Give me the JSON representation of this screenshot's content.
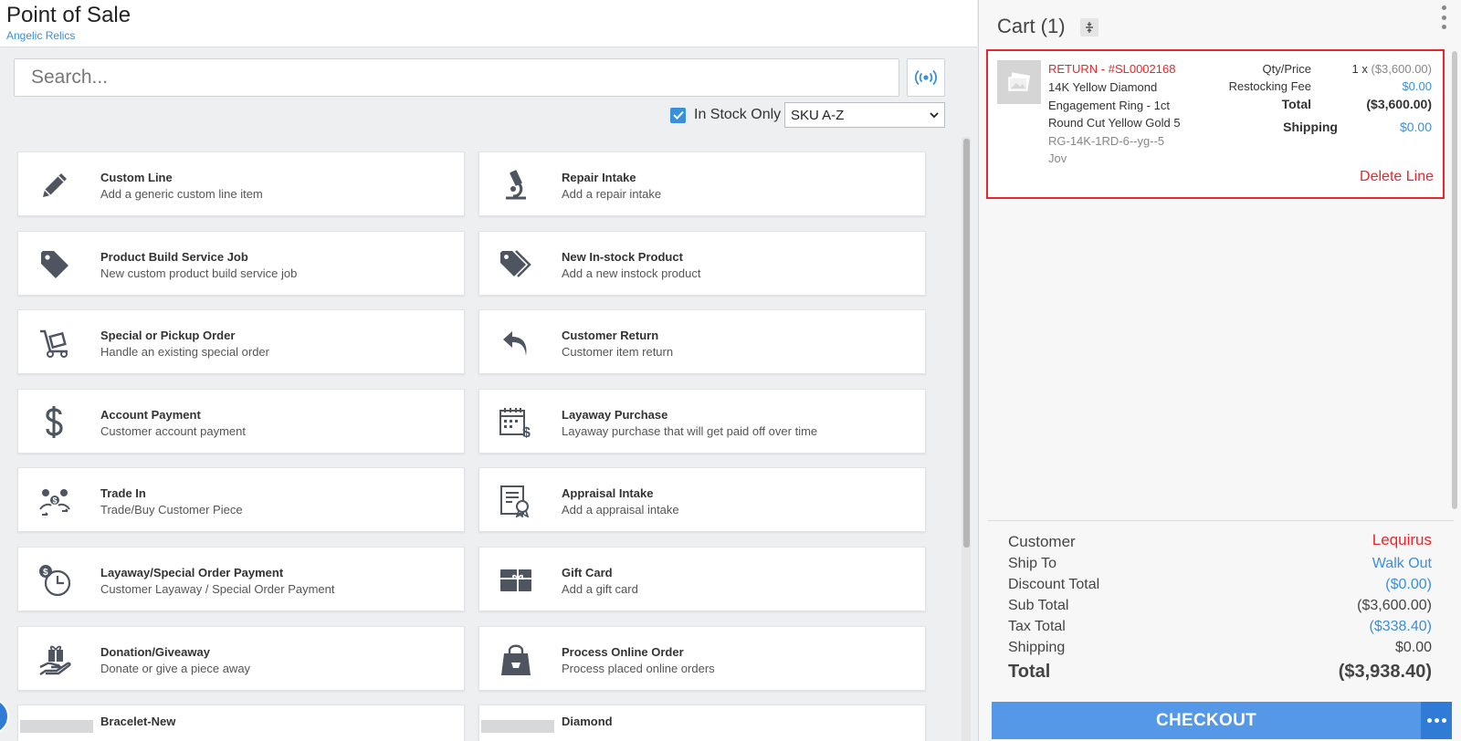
{
  "header": {
    "title": "Point of Sale",
    "store": "Angelic Relics"
  },
  "search": {
    "placeholder": "Search...",
    "value": ""
  },
  "filters": {
    "in_stock_label": "In Stock Only",
    "in_stock_checked": true,
    "sort_value": "SKU A-Z"
  },
  "tiles": [
    {
      "name": "Custom Line",
      "desc": "Add a generic custom line item",
      "icon": "pencil-icon"
    },
    {
      "name": "Repair Intake",
      "desc": "Add a repair intake",
      "icon": "microscope-icon"
    },
    {
      "name": "Product Build Service Job",
      "desc": "New custom product build service job",
      "icon": "tag-icon"
    },
    {
      "name": "New In-stock Product",
      "desc": "Add a new instock product",
      "icon": "tags-icon"
    },
    {
      "name": "Special or Pickup Order",
      "desc": "Handle an existing special order",
      "icon": "dolly-icon"
    },
    {
      "name": "Customer Return",
      "desc": "Customer item return",
      "icon": "return-arrow-icon"
    },
    {
      "name": "Account Payment",
      "desc": "Customer account payment",
      "icon": "dollar-icon"
    },
    {
      "name": "Layaway Purchase",
      "desc": "Layaway purchase that will get paid off over time",
      "icon": "calendar-dollar-icon"
    },
    {
      "name": "Trade In",
      "desc": "Trade/Buy Customer Piece",
      "icon": "trade-icon"
    },
    {
      "name": "Appraisal Intake",
      "desc": "Add a appraisal intake",
      "icon": "certificate-icon"
    },
    {
      "name": "Layaway/Special Order Payment",
      "desc": "Customer Layaway / Special Order Payment",
      "icon": "clock-dollar-icon"
    },
    {
      "name": "Gift Card",
      "desc": "Add a gift card",
      "icon": "gift-card-icon"
    },
    {
      "name": "Donation/Giveaway",
      "desc": "Donate or give a piece away",
      "icon": "hand-gift-icon"
    },
    {
      "name": "Process Online Order",
      "desc": "Process placed online orders",
      "icon": "shopping-bag-icon"
    },
    {
      "name": "Bracelet-New",
      "desc": "",
      "icon": "image-placeholder"
    },
    {
      "name": "Diamond",
      "desc": "",
      "icon": "image-placeholder"
    }
  ],
  "cart": {
    "title": "Cart (1)",
    "item": {
      "return_label": "RETURN - #SL0002168",
      "name": "14K Yellow Diamond Engagement Ring - 1ct Round Cut Yellow Gold 5",
      "sku": "RG-14K-1RD-6--yg--5",
      "vendor": "Jov",
      "qty_price_label": "Qty/Price",
      "qty": "1 x",
      "price": "($3,600.00)",
      "restocking_label": "Restocking Fee",
      "restocking_value": "$0.00",
      "total_label": "Total",
      "total_value": "($3,600.00)",
      "shipping_label": "Shipping",
      "shipping_value": "$0.00",
      "delete_label": "Delete Line"
    },
    "summary": {
      "customer_label": "Customer",
      "customer_value": "Lequirus",
      "ship_to_label": "Ship To",
      "ship_to_value": "Walk Out",
      "discount_label": "Discount Total",
      "discount_value": "($0.00)",
      "subtotal_label": "Sub Total",
      "subtotal_value": "($3,600.00)",
      "tax_label": "Tax Total",
      "tax_value": "($338.40)",
      "shipping_label": "Shipping",
      "shipping_value": "$0.00",
      "total_label": "Total",
      "total_value": "($3,938.40)"
    },
    "checkout_label": "CHECKOUT"
  },
  "colors": {
    "accent": "#3a8fd9",
    "danger": "#e8262c",
    "checkout": "#5598e8",
    "icon": "#4e5560"
  }
}
